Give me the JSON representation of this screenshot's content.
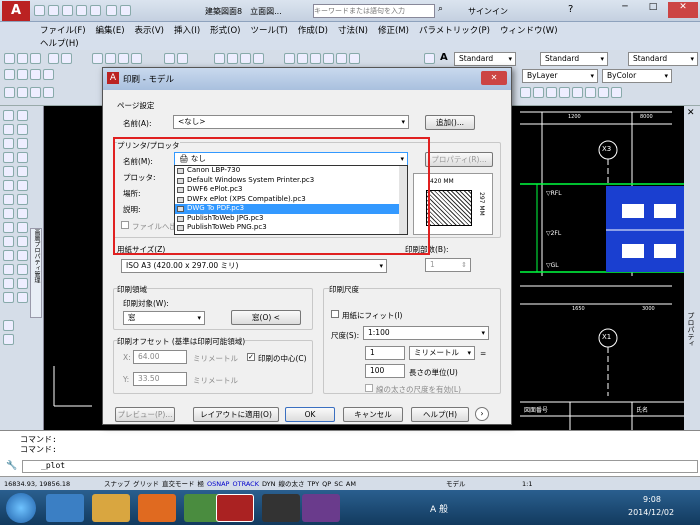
{
  "app": {
    "title": "建築図面8　立面図...",
    "search_placeholder": "キーワードまたは語句を入力",
    "signin": "サインイン"
  },
  "menu": [
    "ファイル(F)",
    "編集(E)",
    "表示(V)",
    "挿入(I)",
    "形式(O)",
    "ツール(T)",
    "作成(D)",
    "寸法(N)",
    "修正(M)",
    "パラメトリック(P)",
    "ウィンドウ(W)",
    "ヘルプ(H)"
  ],
  "toolbar": {
    "style1": "Standard",
    "style2": "Standard",
    "style3": "Standard",
    "layer": "ByLayer",
    "color": "ByColor"
  },
  "dialog": {
    "title": "印刷 - モデル",
    "page_setup": "ページ設定",
    "name_label": "名前(A):",
    "name_value": "<なし>",
    "add_button": "追加()...",
    "printer_group": "プリンタ/プロッタ",
    "printer_name_label": "名前(M):",
    "printer_value": "なし",
    "properties_button": "プロパティ(R)...",
    "plotter_label": "プロッタ:",
    "location_label": "場所:",
    "desc_label": "説明:",
    "file_output": "ファイルへ出力",
    "printers": [
      "Canon LBP-730",
      "Default Windows System Printer.pc3",
      "DWF6 ePlot.pc3",
      "DWFx ePlot (XPS Compatible).pc3",
      "DWG To PDF.pc3",
      "PublishToWeb JPG.pc3",
      "PublishToWeb PNG.pc3"
    ],
    "selected_index": 4,
    "preview_width": "420 MM",
    "preview_height": "297 MM",
    "paper_size_label": "用紙サイズ(Z)",
    "paper_size_value": "ISO A3 (420.00 x 297.00 ミリ)",
    "copies_label": "印刷部数(B):",
    "copies_value": "1",
    "area_group": "印刷領域",
    "area_target_label": "印刷対象(W):",
    "area_target_value": "窓",
    "window_button": "窓(O) <",
    "offset_group": "印刷オフセット (基準は印刷可能領域)",
    "x_label": "X:",
    "x_value": "64.00",
    "y_label": "Y:",
    "y_value": "33.50",
    "unit_mm": "ミリメートル",
    "center_label": "印刷の中心(C)",
    "scale_group": "印刷尺度",
    "fit_label": "用紙にフィット(I)",
    "scale_label": "尺度(S):",
    "scale_value": "1:100",
    "scale_num": "1",
    "scale_unit": "ミリメートル",
    "scale_eq": "=",
    "scale_den": "100",
    "length_unit": "長さの単位(U)",
    "lineweight": "線の太さの尺度を有効(L)",
    "preview_button": "プレビュー(P)...",
    "apply_layout": "レイアウトに適用(O)",
    "ok": "OK",
    "cancel": "キャンセル",
    "help": "ヘルプ(H)"
  },
  "drawing": {
    "x3": "X3",
    "x1": "X1",
    "rfl": "▽RFL",
    "gfl": "▽GL",
    "fl2": "▽2FL",
    "dim1": "1200",
    "dim2": "8000",
    "dim3": "1650",
    "dim4": "3000",
    "title1": "図面番号",
    "title2": "氏名",
    "vert": "プロパティ",
    "layer_manager": "画層プロパティ管理"
  },
  "command": {
    "line1": "コマンド:",
    "line2": "コマンド:",
    "prompt": "_plot"
  },
  "status": {
    "coords": "16834.93, 19856.18",
    "items": [
      "スナップ",
      "グリッド",
      "直交モード",
      "極",
      "OSNAP",
      "OTRACK",
      "DYN",
      "線の太さ",
      "TPY",
      "QP",
      "SC",
      "AM"
    ],
    "model": "モデル",
    "scale": "1:1"
  },
  "taskbar": {
    "time": "9:08",
    "date": "2014/12/02",
    "ime": "A 般"
  }
}
